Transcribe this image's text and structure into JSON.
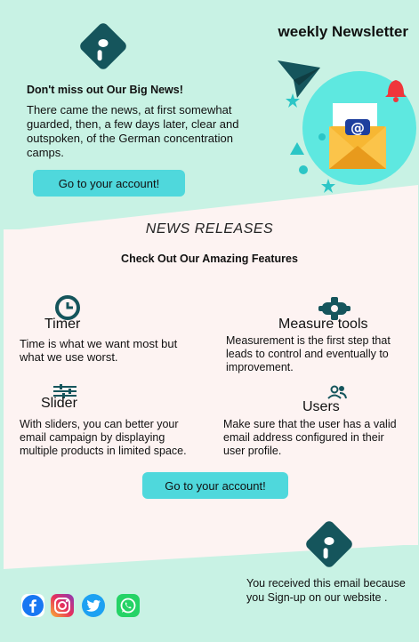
{
  "header": {
    "title": "weekly Newsletter"
  },
  "hero": {
    "subtitle": "Don't miss out Our Big News!",
    "text": "There came the news, at first somewhat guarded, then, a few days later, clear and outspoken, of the German concentration camps.",
    "button_label": "Go to your account!"
  },
  "features_section": {
    "heading": "NEWS RELEASES",
    "subheading": "Check Out Our Amazing Features",
    "items": [
      {
        "title": "Timer",
        "desc": "Time is what we want most but what we use worst.",
        "icon": "timer-icon"
      },
      {
        "title": "Measure tools",
        "desc": "Measurement is the first step that leads to control and eventually to improvement.",
        "icon": "gear-icon"
      },
      {
        "title": "Slider",
        "desc": "With sliders, you can better your email campaign by displaying multiple products in limited space.",
        "icon": "sliders-icon"
      },
      {
        "title": "Users",
        "desc": "Make sure that the user has a valid email address configured in their user profile.",
        "icon": "users-icon"
      }
    ],
    "button_label": "Go to your account!"
  },
  "footer": {
    "text": "You  received this email because  you Sign-up on our website .",
    "social": [
      "facebook-icon",
      "instagram-icon",
      "twitter-icon",
      "whatsapp-icon"
    ]
  },
  "colors": {
    "background": "#c8f2e4",
    "accent": "#4fd8dc",
    "dark": "#15555c",
    "section": "#fdf3f2"
  }
}
